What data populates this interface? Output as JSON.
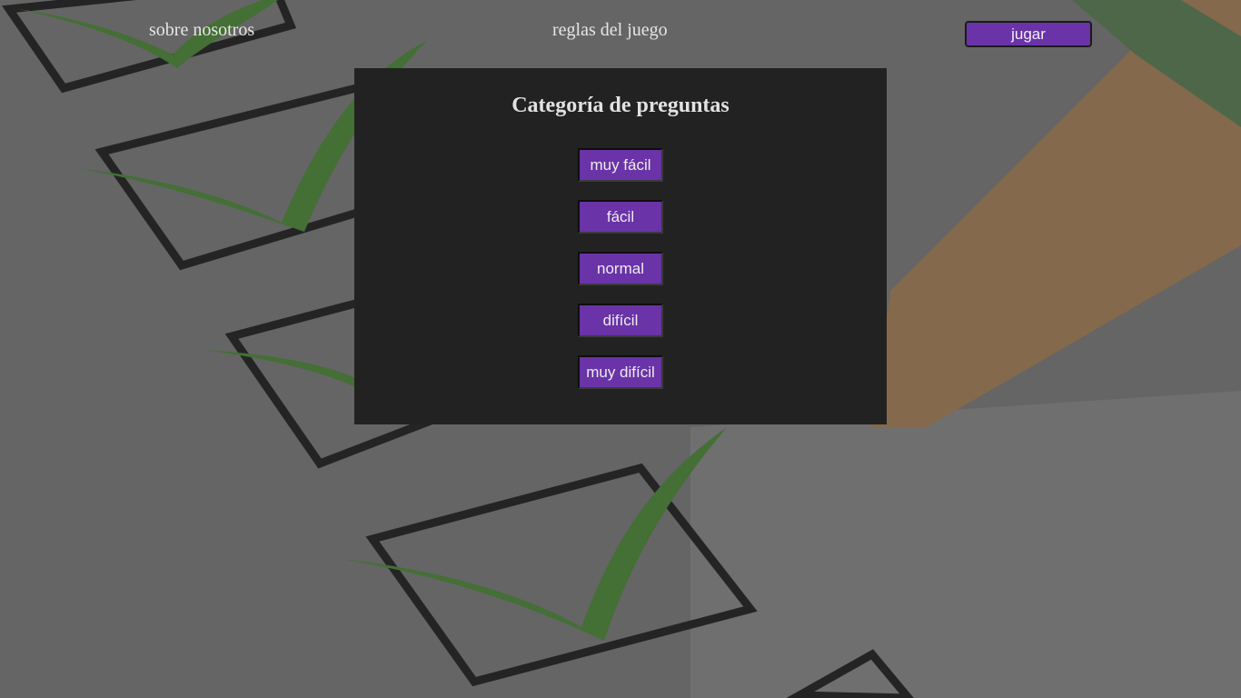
{
  "nav": {
    "about_label": "sobre nosotros",
    "rules_label": "reglas del juego",
    "play_label": "jugar"
  },
  "panel": {
    "title": "Categoría de preguntas",
    "categories": [
      {
        "label": "muy fácil"
      },
      {
        "label": "fácil"
      },
      {
        "label": "normal"
      },
      {
        "label": "difícil"
      },
      {
        "label": "muy difícil"
      }
    ]
  },
  "colors": {
    "accent": "#6a33a8",
    "panel_bg": "#222222",
    "text_light": "#e6e6e6"
  },
  "background": {
    "icon": "checklist-checkboxes-illustration"
  }
}
